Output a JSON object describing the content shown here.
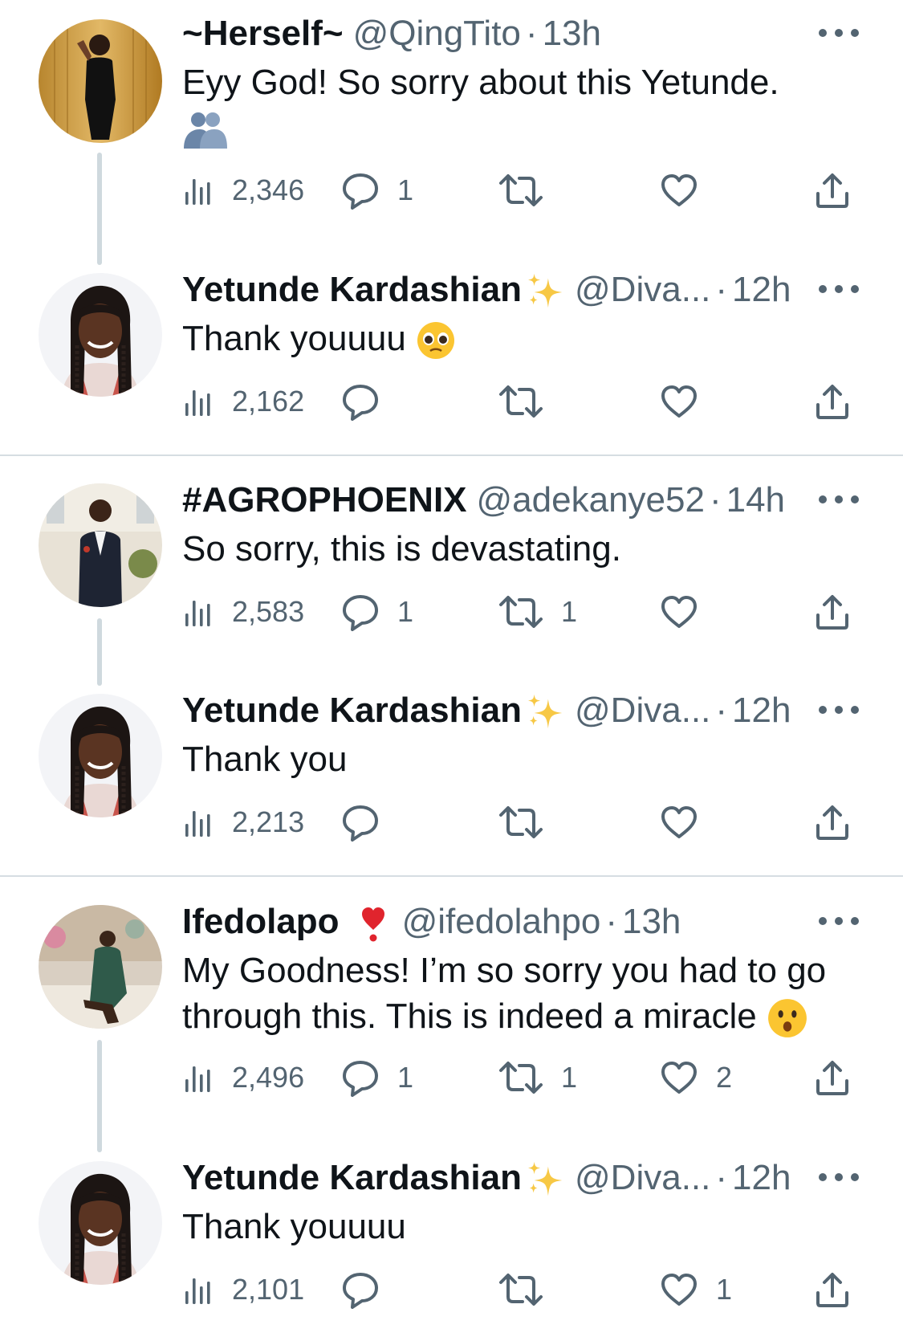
{
  "tweets": [
    {
      "name": "~Herself~",
      "name_emoji": "",
      "handle": "@QingTito",
      "time": "13h",
      "text": "Eyy God! So sorry about this Yetunde.",
      "text_emoji": "people-hugging",
      "views": "2,346",
      "replies": "1",
      "retweets": "",
      "likes": ""
    },
    {
      "name": "Yetunde Kardashian",
      "name_emoji": "sparkles",
      "handle": "@Diva...",
      "time": "12h",
      "text": "Thank youuuu",
      "text_emoji": "pleading-face",
      "views": "2,162",
      "replies": "",
      "retweets": "",
      "likes": ""
    },
    {
      "name": "#AGROPHOENIX",
      "name_emoji": "",
      "handle": "@adekanye52",
      "time": "14h",
      "text": "So sorry, this is devastating.",
      "text_emoji": "",
      "views": "2,583",
      "replies": "1",
      "retweets": "1",
      "likes": ""
    },
    {
      "name": "Yetunde Kardashian",
      "name_emoji": "sparkles",
      "handle": "@Diva...",
      "time": "12h",
      "text": "Thank you",
      "text_emoji": "",
      "views": "2,213",
      "replies": "",
      "retweets": "",
      "likes": ""
    },
    {
      "name": "Ifedolapo",
      "name_emoji": "red-heart-exclamation",
      "handle": "@ifedolahpo",
      "time": "13h",
      "text_line1": "My Goodness! I’m so sorry you had to go",
      "text_line2": "through this. This is indeed a miracle",
      "text_emoji": "hushed-face",
      "views": "2,496",
      "replies": "1",
      "retweets": "1",
      "likes": "2"
    },
    {
      "name": "Yetunde Kardashian",
      "name_emoji": "sparkles",
      "handle": "@Diva...",
      "time": "12h",
      "text": "Thank youuuu",
      "text_emoji": "",
      "views": "2,101",
      "replies": "",
      "retweets": "",
      "likes": "1"
    }
  ],
  "colors": {
    "text": "#0f1419",
    "muted": "#536471",
    "thread_line": "#cfd9de",
    "separator": "#d6dde2",
    "emoji_yellow": "#fbc531",
    "hug_blue": "#6b86a8",
    "heart_red": "#e0242d"
  },
  "icons": [
    "views-icon",
    "reply-icon",
    "retweet-icon",
    "like-icon",
    "share-icon",
    "more-icon"
  ]
}
